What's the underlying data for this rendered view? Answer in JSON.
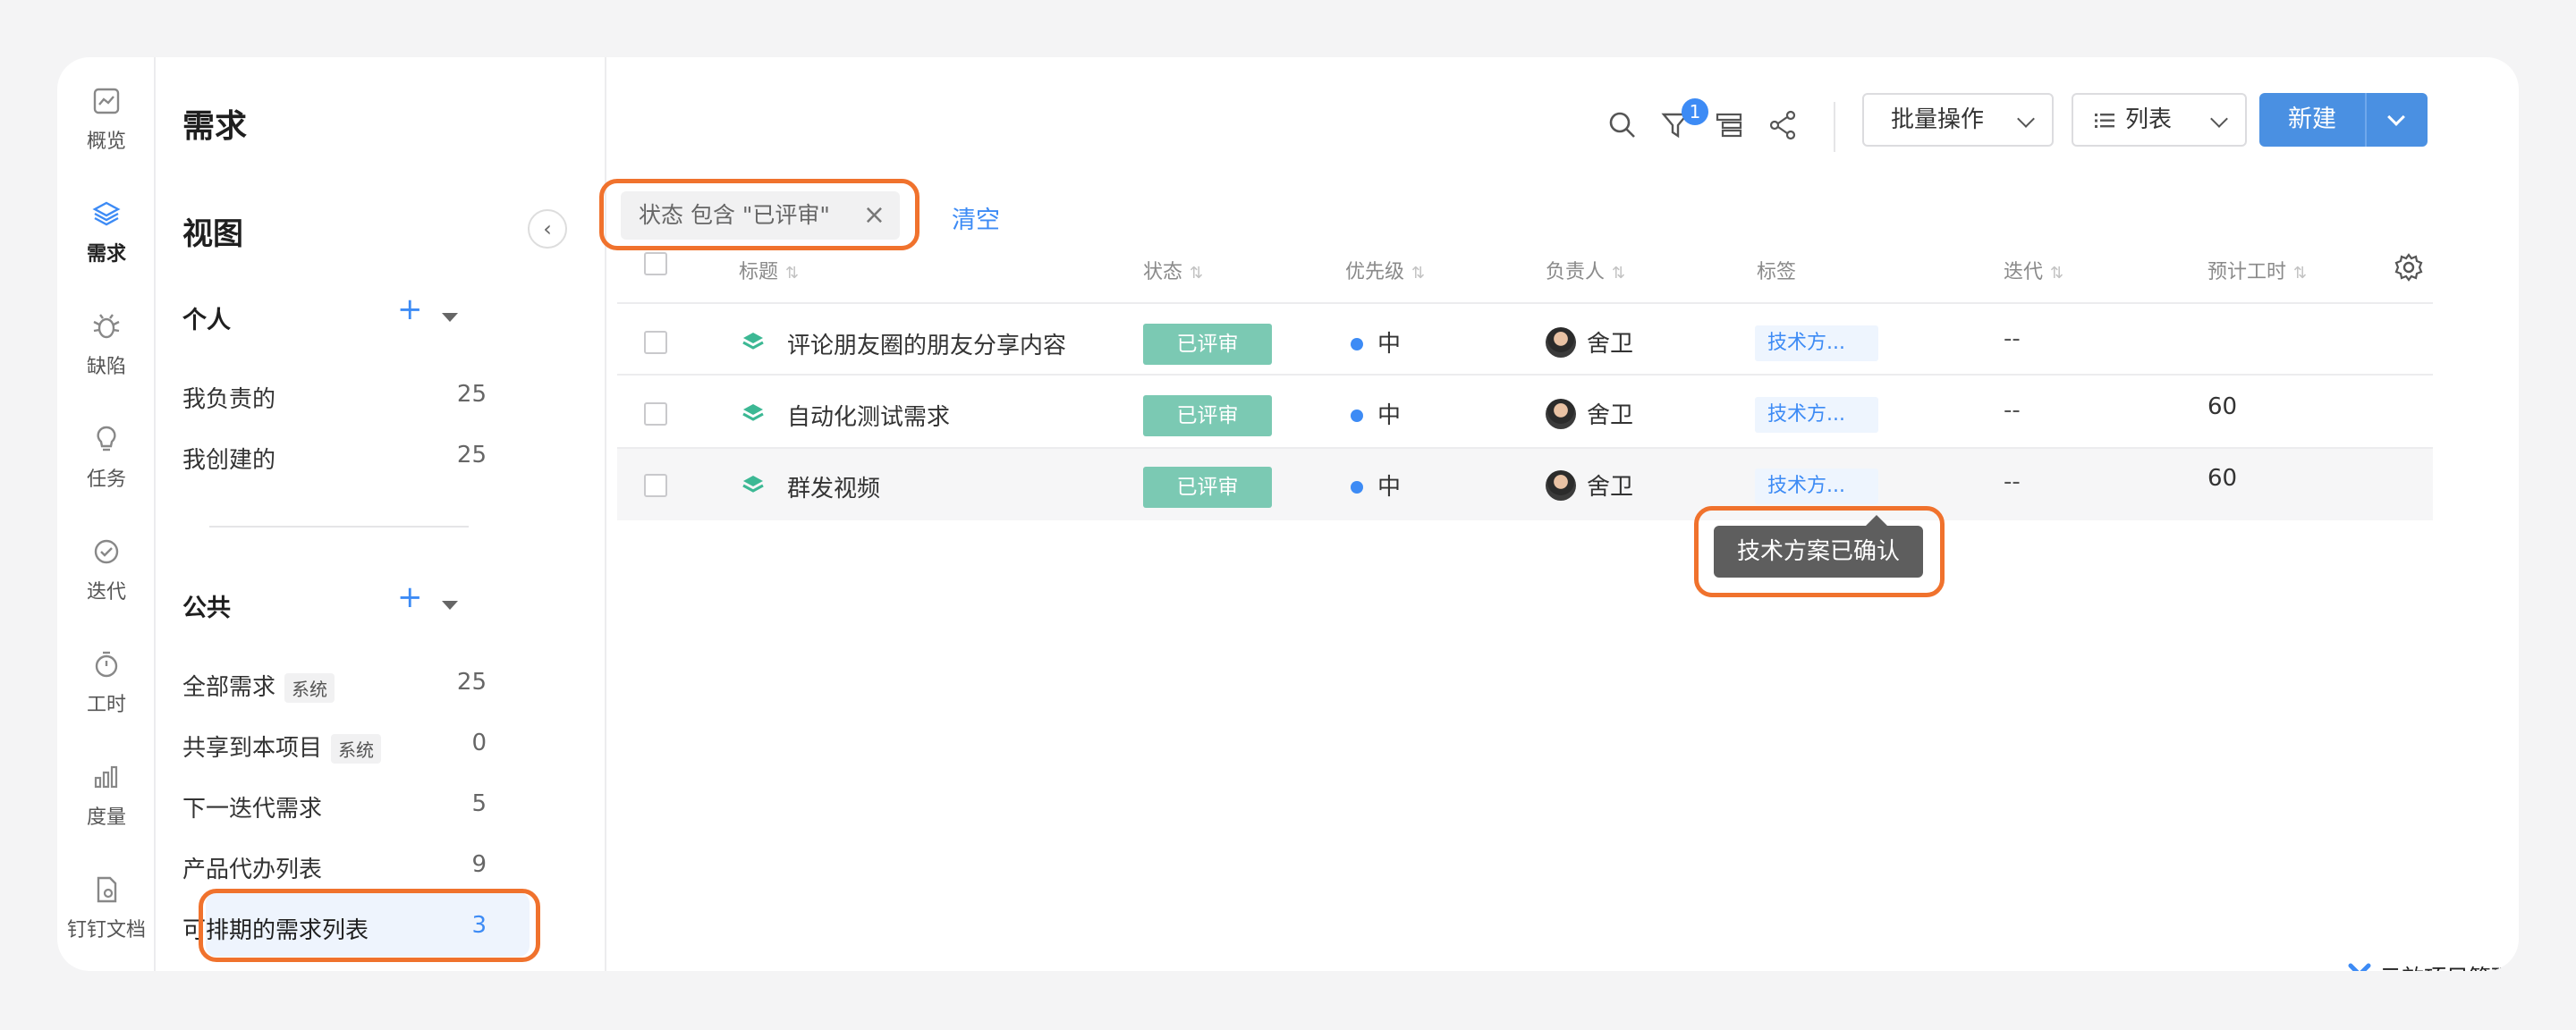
{
  "nav": [
    {
      "label": "概览",
      "icon": "overview-icon"
    },
    {
      "label": "需求",
      "icon": "layers-icon"
    },
    {
      "label": "缺陷",
      "icon": "bug-icon"
    },
    {
      "label": "任务",
      "icon": "bulb-icon"
    },
    {
      "label": "迭代",
      "icon": "cycle-icon"
    },
    {
      "label": "工时",
      "icon": "stopwatch-icon"
    },
    {
      "label": "度量",
      "icon": "bar-chart-icon"
    },
    {
      "label": "钉钉文档",
      "icon": "doc-icon"
    }
  ],
  "page_title": "需求",
  "views": {
    "title": "视图",
    "personal": {
      "label": "个人",
      "items": [
        {
          "label": "我负责的",
          "count": "25"
        },
        {
          "label": "我创建的",
          "count": "25"
        }
      ]
    },
    "public": {
      "label": "公共",
      "items": [
        {
          "label": "全部需求",
          "tag": "系统",
          "count": "25"
        },
        {
          "label": "共享到本项目",
          "tag": "系统",
          "count": "0"
        },
        {
          "label": "下一迭代需求",
          "count": "5"
        },
        {
          "label": "产品代办列表",
          "count": "9"
        },
        {
          "label": "可排期的需求列表",
          "count": "3"
        }
      ]
    }
  },
  "toolbar": {
    "filter_badge": "1",
    "batch_label": "批量操作",
    "view_mode_label": "列表",
    "new_label": "新建"
  },
  "filter": {
    "chip_text": "状态 包含 \"已评审\"",
    "clear_label": "清空"
  },
  "table": {
    "headers": [
      "标题",
      "状态",
      "优先级",
      "负责人",
      "标签",
      "迭代",
      "预计工时"
    ],
    "rows": [
      {
        "title": "评论朋友圈的朋友分享内容",
        "status": "已评审",
        "priority": "中",
        "owner": "舍卫",
        "tag": "技术方...",
        "iteration": "--",
        "hours": ""
      },
      {
        "title": "自动化测试需求",
        "status": "已评审",
        "priority": "中",
        "owner": "舍卫",
        "tag": "技术方...",
        "iteration": "--",
        "hours": "60"
      },
      {
        "title": "群发视频",
        "status": "已评审",
        "priority": "中",
        "owner": "舍卫",
        "tag": "技术方...",
        "iteration": "--",
        "hours": "60"
      }
    ]
  },
  "tooltip": "技术方案已确认",
  "brand": "云效项目管理",
  "colors": {
    "accent": "#3d8bf5",
    "status_reviewed": "#7bc9b3",
    "highlight": "#f0722d"
  }
}
